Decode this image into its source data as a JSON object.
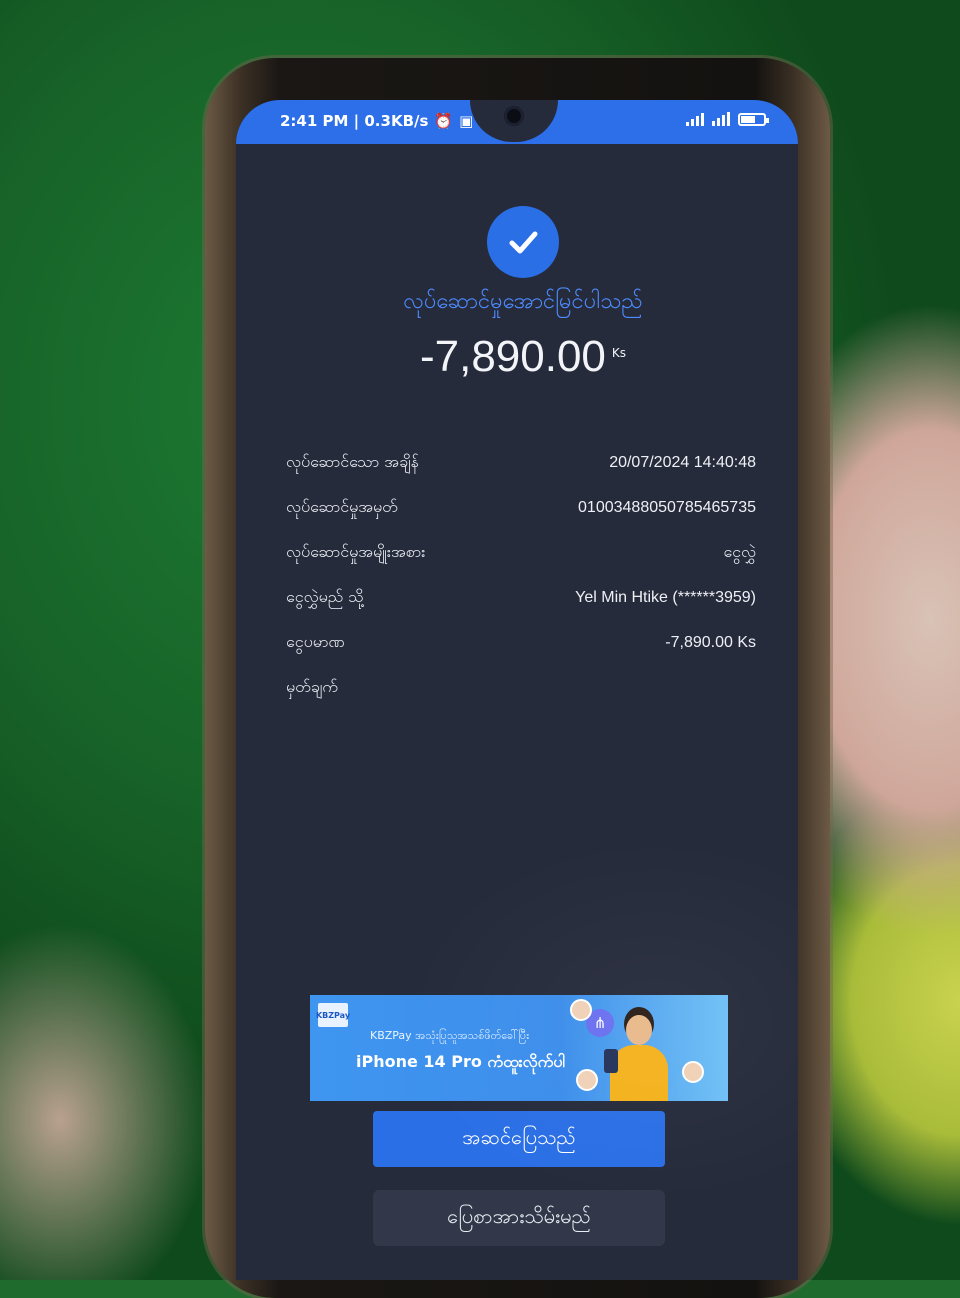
{
  "status_bar": {
    "time_speed": "2:41 PM | 0.3KB/s",
    "icons": [
      "alarm-icon",
      "app-icon",
      "more-dots-icon",
      "signal-icon",
      "wifi-icon",
      "battery-icon"
    ]
  },
  "receipt": {
    "success_icon": "check-icon",
    "title": "လုပ်ဆောင်မှုအောင်မြင်ပါသည်",
    "amount": "-7,890.00",
    "currency": "Ks",
    "rows": [
      {
        "label": "လုပ်ဆောင်သော အချိန်",
        "value": "20/07/2024 14:40:48"
      },
      {
        "label": "လုပ်ဆောင်မှုအမှတ်",
        "value": "01003488050785465735"
      },
      {
        "label": "လုပ်ဆောင်မှုအမျိုးအစား",
        "value": "ငွေလွှဲ"
      },
      {
        "label": "ငွေလွှဲမည် သို့",
        "value": "Yel Min Htike (******3959)"
      },
      {
        "label": "ငွေပမာဏ",
        "value": "-7,890.00 Ks"
      },
      {
        "label": "မှတ်ချက်",
        "value": ""
      }
    ]
  },
  "banner": {
    "logo_text": "KBZPay",
    "line1": "KBZPay အသုံးပြုသူအသစ်ဖိတ်ခေါ်ပြီး",
    "line2": "iPhone 14 Pro ကံထူးလိုက်ပါ"
  },
  "buttons": {
    "done": "အဆင်ပြေသည်",
    "save_receipt": "ပြေစာအားသိမ်းမည်"
  },
  "colors": {
    "accent": "#2b6fe6",
    "background": "#262b3c",
    "title_blue": "#4d8cff"
  }
}
